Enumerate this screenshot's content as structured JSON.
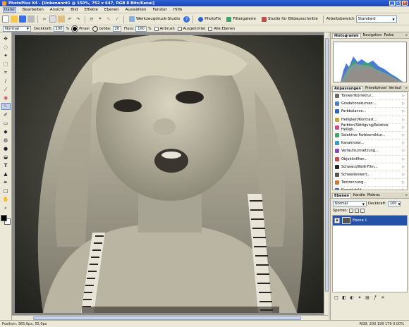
{
  "title": "PhotoPlus X4 - [Unbenannt1 @ 150%, 752 x 647, RGB 8 Bits/Kanal]",
  "window_buttons": {
    "minimize": "_",
    "maximize": "□",
    "close": "×"
  },
  "menu": [
    "Datei",
    "Bearbeiten",
    "Ansicht",
    "Bild",
    "Effekte",
    "Ebenen",
    "Auswählen",
    "Fenster",
    "Hilfe"
  ],
  "toolbar": {
    "workspace_studio": "Werkzeugdruck-Studio",
    "photofix": "PhotoFix",
    "filtergalerie": "Filtergalerie",
    "studio_bildausschnitte": "Studio für Bildausschnitte",
    "arbeitsbereich_label": "Arbeitsbereich",
    "arbeitsbereich_value": "Standard"
  },
  "tool_options": {
    "mode": "Normal",
    "deckkraft_label": "Deckkraft:",
    "deckkraft_value": "100",
    "percent": "%",
    "pinsel_label": "Pinsel",
    "groesse_label": "Größe:",
    "groesse_value": "20",
    "fluss_label": "Fluss:",
    "fluss_value": "100",
    "airbrush": "Airbrush",
    "ausgerichtet": "Ausgerichtet",
    "alle_ebenen": "Alle Ebenen"
  },
  "histogram_panel": {
    "tabs": [
      "Histogramm",
      "Navigation",
      "Farbe"
    ]
  },
  "adjustments_panel": {
    "tabs": [
      "Anpassungen",
      "Presetpinsel",
      "Verlauf"
    ],
    "items": [
      {
        "label": "Tonwertkorrektur...",
        "color": "#6a6a6a"
      },
      {
        "label": "Gradationskurven...",
        "color": "#4a7fc1"
      },
      {
        "label": "Farbbalance...",
        "color": "#2a64c8"
      },
      {
        "label": "Helligkeit/Kontrast...",
        "color": "#c8a23a"
      },
      {
        "label": "Farbton/Sättigung/Relative Helligk...",
        "color": "#d24a8a"
      },
      {
        "label": "Selektive Farbkorrektur...",
        "color": "#3aa86a"
      },
      {
        "label": "Kanalmixer...",
        "color": "#3a9ac8"
      },
      {
        "label": "Verlaufsumsetzung...",
        "color": "#8a4ac8"
      },
      {
        "label": "Objektivfilter...",
        "color": "#c84a4a"
      },
      {
        "label": "Schwarz/Weiß-Film...",
        "color": "#222222"
      },
      {
        "label": "Schwellenwert...",
        "color": "#555555"
      },
      {
        "label": "Tontrennung...",
        "color": "#c87a3a"
      },
      {
        "label": "Negativbild...",
        "color": "#3a6ac8"
      }
    ]
  },
  "layers_panel": {
    "tabs": [
      "Ebenen",
      "Kanäle",
      "Makros"
    ],
    "mode": "Normal",
    "deckkraft_label": "Deckkraft:",
    "deckkraft_value": "100",
    "sperren_label": "Sperren:",
    "layers": [
      {
        "name": "Ebene 1"
      }
    ]
  },
  "status": {
    "position": "Position: 365,0px, 55,0px",
    "rgb": "RGB: 200 199 179 0.00%"
  }
}
